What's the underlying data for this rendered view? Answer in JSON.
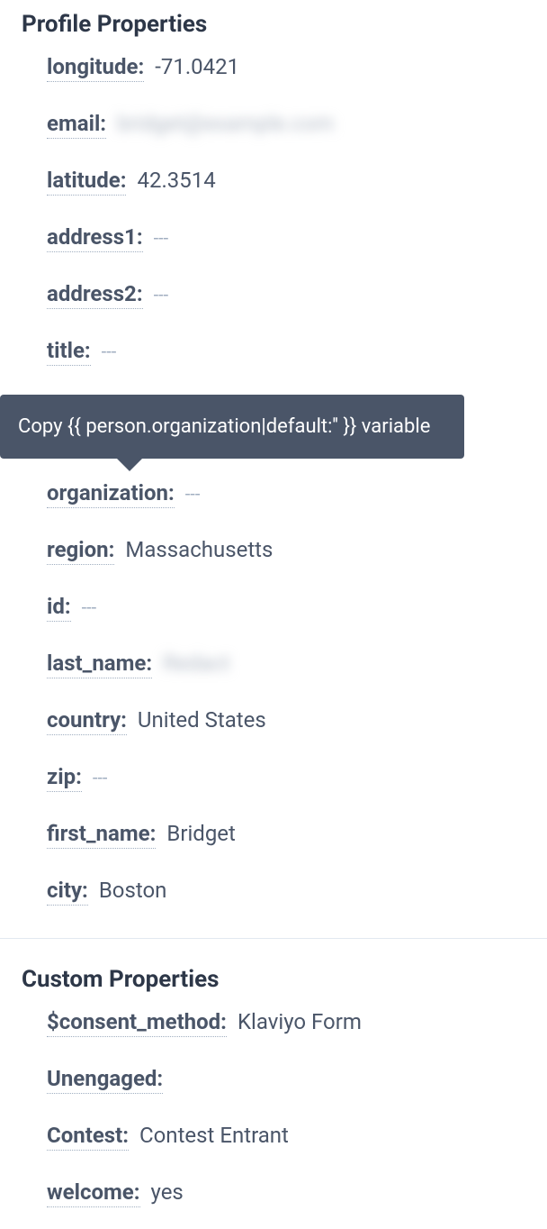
{
  "profile": {
    "title": "Profile Properties",
    "properties": {
      "longitude": {
        "label": "longitude:",
        "value": "-71.0421"
      },
      "email": {
        "label": "email:",
        "value": "bridget@example.com",
        "blurred": true
      },
      "latitude": {
        "label": "latitude:",
        "value": "42.3514"
      },
      "address1": {
        "label": "address1:",
        "value": "---",
        "empty": true
      },
      "address2": {
        "label": "address2:",
        "value": "---",
        "empty": true
      },
      "title_prop": {
        "label": "title:",
        "value": "---",
        "empty": true
      },
      "organization": {
        "label": "organization:",
        "value": "---",
        "empty": true
      },
      "region": {
        "label": "region:",
        "value": "Massachusetts"
      },
      "id": {
        "label": "id:",
        "value": "---",
        "empty": true
      },
      "last_name": {
        "label": "last_name:",
        "value": "Redact",
        "blurred": true
      },
      "country": {
        "label": "country:",
        "value": "United States"
      },
      "zip": {
        "label": "zip:",
        "value": "---",
        "empty": true
      },
      "first_name": {
        "label": "first_name:",
        "value": "Bridget"
      },
      "city": {
        "label": "city:",
        "value": "Boston"
      }
    }
  },
  "tooltip": {
    "text": "Copy {{ person.organization|default:'' }} variable"
  },
  "custom": {
    "title": "Custom Properties",
    "properties": {
      "consent_method": {
        "label": "$consent_method:",
        "value": "Klaviyo Form"
      },
      "unengaged": {
        "label": "Unengaged:",
        "value": ""
      },
      "contest": {
        "label": "Contest:",
        "value": "Contest Entrant"
      },
      "welcome": {
        "label": "welcome:",
        "value": "yes"
      }
    }
  }
}
